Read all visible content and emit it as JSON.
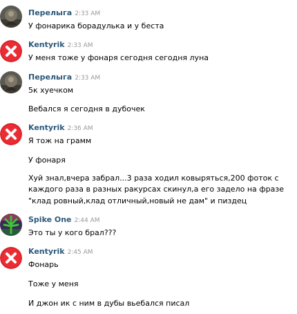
{
  "messages": [
    {
      "author": "Перелыга",
      "time": "2:33 AM",
      "avatar": "profile-photo",
      "lines": [
        "У фонарика борадулька и у беста"
      ]
    },
    {
      "author": "Kentyrik",
      "time": "2:33 AM",
      "avatar": "deleted-user-red-x",
      "lines": [
        "У меня тоже у фонаря сегодня сегодня луна"
      ]
    },
    {
      "author": "Перелыга",
      "time": "2:33 AM",
      "avatar": "profile-photo",
      "lines": [
        "5к хуечком",
        "Вебался я сегодня в дубочек"
      ]
    },
    {
      "author": "Kentyrik",
      "time": "2:36 AM",
      "avatar": "deleted-user-red-x",
      "lines": [
        "Я тож на грамм",
        "У фонаря",
        "Хуй знал,вчера забрал...3 раза ходил ковыряться,200 фоток с",
        "каждого раза в разных ракурсах скинул,а его задело на фразе",
        "\"клад ровный,клад отличный,новый не дам\" и пиздец"
      ]
    },
    {
      "author": "Spike One",
      "time": "2:44 AM",
      "avatar": "green-leaf-photo",
      "lines": [
        "Это ты у кого брал???"
      ]
    },
    {
      "author": "Kentyrik",
      "time": "2:45 AM",
      "avatar": "deleted-user-red-x",
      "lines": [
        "Фонарь",
        "Тоже у меня",
        "И джон ик с ним в дубы вьебался писал"
      ]
    }
  ],
  "colors": {
    "name": "#2b587a",
    "time": "#999999",
    "text": "#000000",
    "deleted_avatar_red": "#d8232a"
  }
}
